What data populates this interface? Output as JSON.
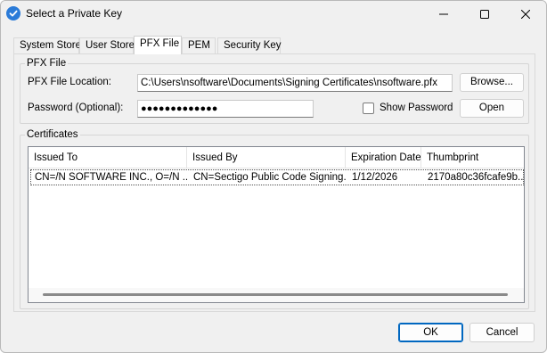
{
  "window": {
    "title": "Select a Private Key"
  },
  "tabs": [
    {
      "label": "System Store"
    },
    {
      "label": "User Store"
    },
    {
      "label": "PFX File"
    },
    {
      "label": "PEM"
    },
    {
      "label": "Security Key"
    }
  ],
  "active_tab": "PFX File",
  "pfx_group": {
    "label": "PFX File",
    "location_label": "PFX File Location:",
    "location_value": "C:\\Users\\nsoftware\\Documents\\Signing Certificates\\nsoftware.pfx",
    "browse_label": "Browse...",
    "password_label": "Password (Optional):",
    "password_value": "●●●●●●●●●●●●●",
    "show_password_label": "Show Password",
    "show_password_checked": false,
    "open_label": "Open"
  },
  "certificates_group": {
    "label": "Certificates",
    "columns": [
      "Issued To",
      "Issued By",
      "Expiration Date",
      "Thumbprint"
    ],
    "rows": [
      {
        "issued_to": "CN=/N SOFTWARE INC., O=/N ...",
        "issued_by": "CN=Sectigo Public Code Signing...",
        "expiration": "1/12/2026",
        "thumbprint": "2170a80c36fcafe9b..."
      }
    ]
  },
  "footer": {
    "ok_label": "OK",
    "cancel_label": "Cancel"
  },
  "colors": {
    "accent": "#0067c0",
    "icon_blue": "#2b7bd8"
  }
}
